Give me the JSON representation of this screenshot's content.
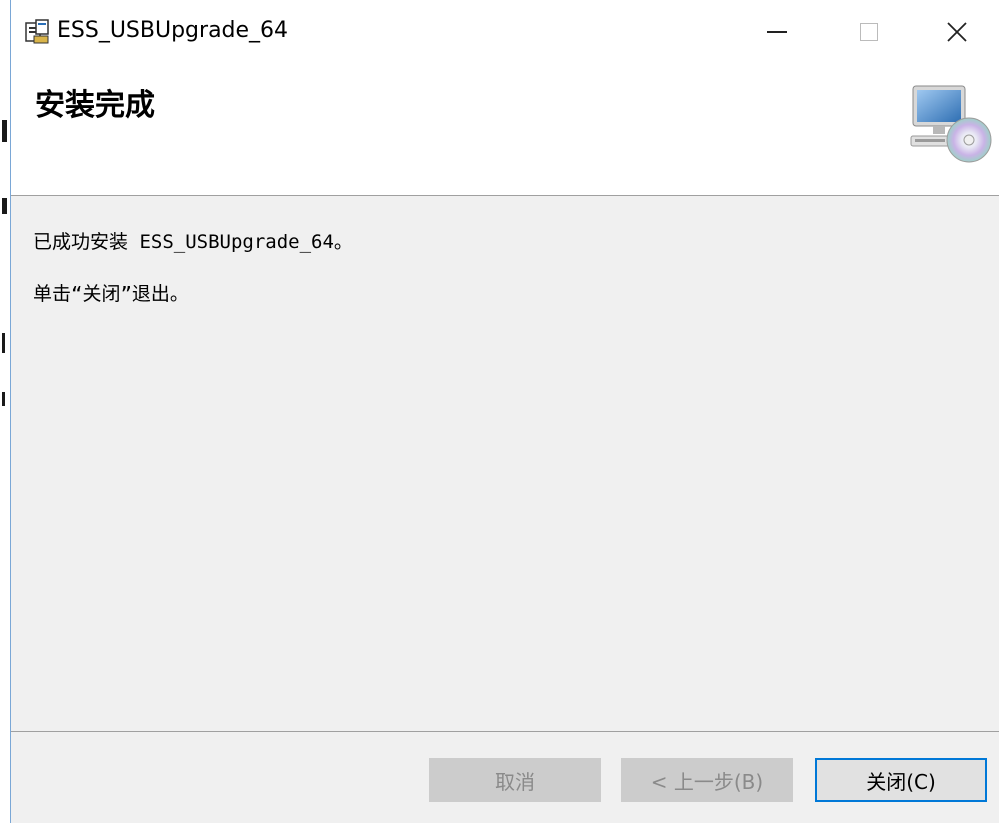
{
  "window": {
    "title": "ESS_USBUpgrade_64",
    "minimize_icon": "minimize-icon",
    "maximize_icon": "maximize-icon",
    "close_icon": "close-icon",
    "close_glyph": "✕"
  },
  "banner": {
    "title": "安装完成",
    "graphic": "computer-with-disc-icon"
  },
  "content": {
    "line1": "已成功安装 ESS_USBUpgrade_64。",
    "line2": "单击“关闭”退出。"
  },
  "buttons": {
    "cancel": "取消",
    "back": "< 上一步(B)",
    "close": "关闭(C)"
  },
  "colors": {
    "accent": "#0078d7",
    "window_bg": "#f0f0f0",
    "disabled_button": "#cccccc"
  }
}
